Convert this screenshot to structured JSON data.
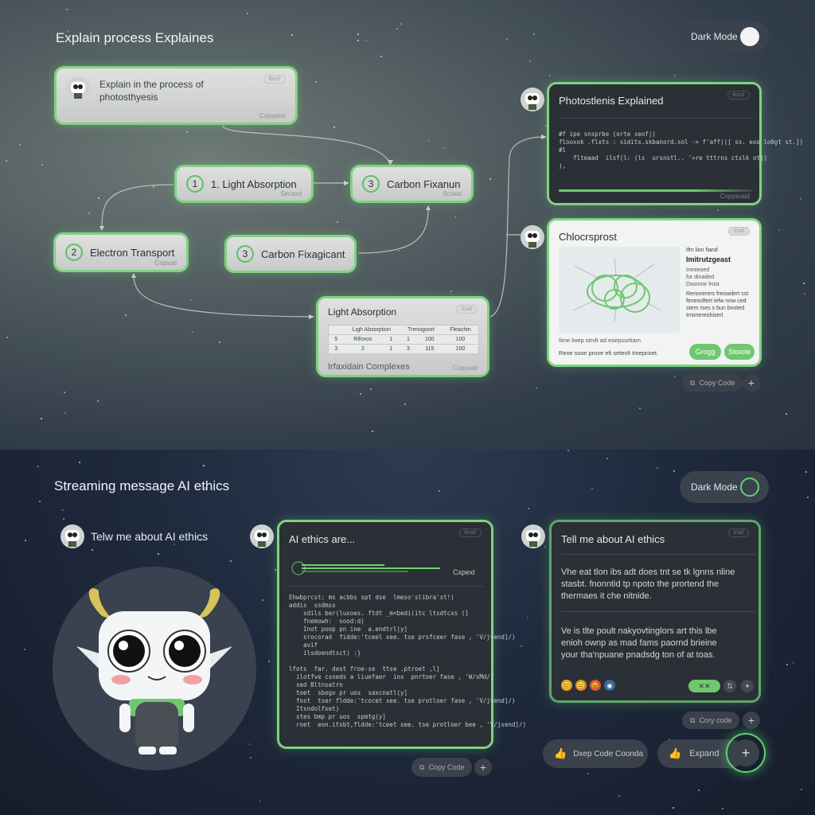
{
  "top": {
    "title": "Explain process Explaines",
    "dark_mode_label": "Dark Mode",
    "prompt": {
      "text": "Explain in the process of photosthyesis",
      "tag": "lbmil",
      "sub": "Copypsst"
    },
    "nodes": [
      {
        "num": "1",
        "label": "1. Light Absorption",
        "sub": "Secaxd"
      },
      {
        "num": "3",
        "label": "Carbon Fixanun",
        "sub": "Scxaid"
      },
      {
        "num": "2",
        "label": "Electron Transport",
        "sub": "Copsod"
      },
      {
        "num": "3",
        "label": "Carbon Fixagicant",
        "sub": ""
      }
    ],
    "light_card": {
      "title": "Light Absorption",
      "tag": "lcad",
      "table_headers": [
        "Ligh Absorption",
        "Trenogoort",
        "Fleachin"
      ],
      "table_rows": [
        [
          "5",
          "Rifoxos",
          "1",
          "1",
          "100",
          "100"
        ],
        [
          "3",
          "2",
          "1",
          "3",
          "115",
          "100"
        ]
      ],
      "footer": "Irfaxidain Complexes",
      "sub": "Copysati"
    },
    "code_card": {
      "title": "Photostlenis Explained",
      "tag": "llocd",
      "code": "#f ipe snsprbe (orte seof|)\nflooxok .flxts : sidits.skbanord.sol -> f'aff(([ ss. exo lo0ot st.])\n#l\n    flteaad  ilsf(l: (ls  ursnstl.. '=re tttrns ctslk ot])\n),",
      "sub": "Copyscaid"
    },
    "diagram_card": {
      "title": "Chlocrsprost",
      "tag": "lcad",
      "side_1": "Ifm lion fiand",
      "side_2": "Imitrutzgeast",
      "side_3": "Ironieoed\nfor dinaded",
      "side_4": "Dsonnor lrost",
      "side_5": "Renoverers freowdert sst\nftmesoftert iefw nnw ced\nstern rses s bun bnoted\nIrnimereohiserl.",
      "foot_1": "Ilme lwep strvlt ad esepsurtiam",
      "foot_2": "Rexe ssoe prove efi setevlt tmeprixet.",
      "btn_1": "Grogg",
      "btn_2": "Stoiote"
    },
    "copy_code": "Copy Code"
  },
  "bottom": {
    "title": "Streaming message AI ethics",
    "dark_mode_label": "Dark Mode",
    "user_msg": "Telw me about AI ethics",
    "stream_card": {
      "title": "AI ethics are...",
      "tag": "llosd",
      "stream_label": "Cxpexl",
      "code": "Ehwbprcst: ms acbbs spt dse  lmeso'slibra'st!)\naddis  ssdmss\n    sdils ber(luxoes. ftdt _m<bedi(itc ltsdtcxs (]\n    fnemowh:  sood:d)\n    Inot poop pn ine  a.endtrl|y]\n    srocorad  fidde:'tceel xee. tse prsfceer fase , 'V/jvend]/)\n    avif\n    ilsdoendtsct) :}\n\nlfots  far. dest froe-se  ttse .ptroet ,l]\n  ilotfve csneds a liuefaer  ins  pnrtoer fase , 'W/sMd/]\n  sed Bltnsatrn\n  toet  sbogv pr uos  saxcnatl(y]\n  fost  tser fldde:'tcocet xee. tse protloer fase , 'V/jvend]/)\n  Itsndolfxet)\n  stes bmp pr uos  spmtg(y]\n  roet  eon.itsbt,fldde:'tceet xee. tse protloer bee , 'V/jsend]/)",
      "copy_code": "Copy Code"
    },
    "answer_card": {
      "title": "Tell me about AI ethics",
      "tag": "lcsd",
      "para_1": "Vhe eat tlon ibs adt does tnt se tk lgnns nline\nstasbt. fnonntid tp npoto the prortend the\nthermaes it che nitnide.",
      "para_2": "Ve is tlte poult nakyovtinglors art this lbe\nenioh ownp as mad fams paornd brieine\nyour tha'npuane pnadsdg ton of at toas.",
      "reactions": [
        "😊",
        "😐",
        "😡",
        "◉"
      ],
      "badge": "✕✕"
    },
    "copy_code": "Cory code",
    "btn_deep_code": "Dxep Code Coonda",
    "btn_expand": "Expand"
  }
}
